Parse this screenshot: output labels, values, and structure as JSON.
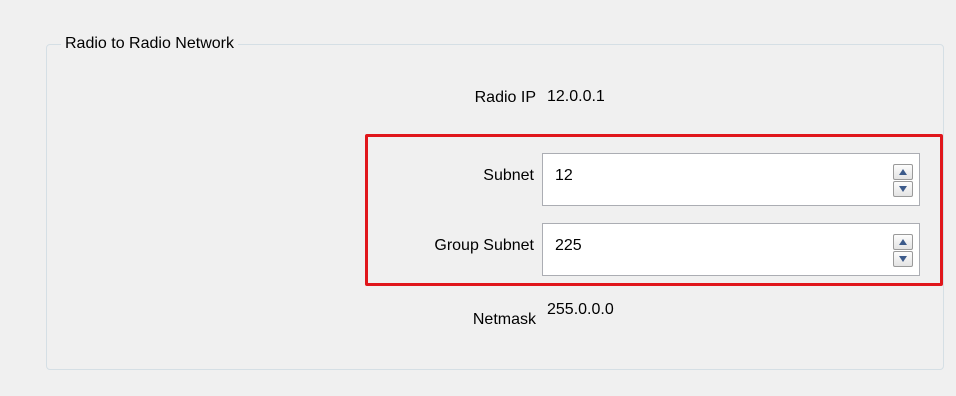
{
  "group": {
    "title": "Radio to Radio Network"
  },
  "radio_ip": {
    "label": "Radio IP",
    "value": "12.0.0.1"
  },
  "subnet": {
    "label": "Subnet",
    "value": "12"
  },
  "group_subnet": {
    "label": "Group Subnet",
    "value": "225"
  },
  "netmask": {
    "label": "Netmask",
    "value": "255.0.0.0"
  },
  "colors": {
    "highlight": "#e0161b",
    "background": "#f0f0f0",
    "field_border": "#abadb3"
  }
}
